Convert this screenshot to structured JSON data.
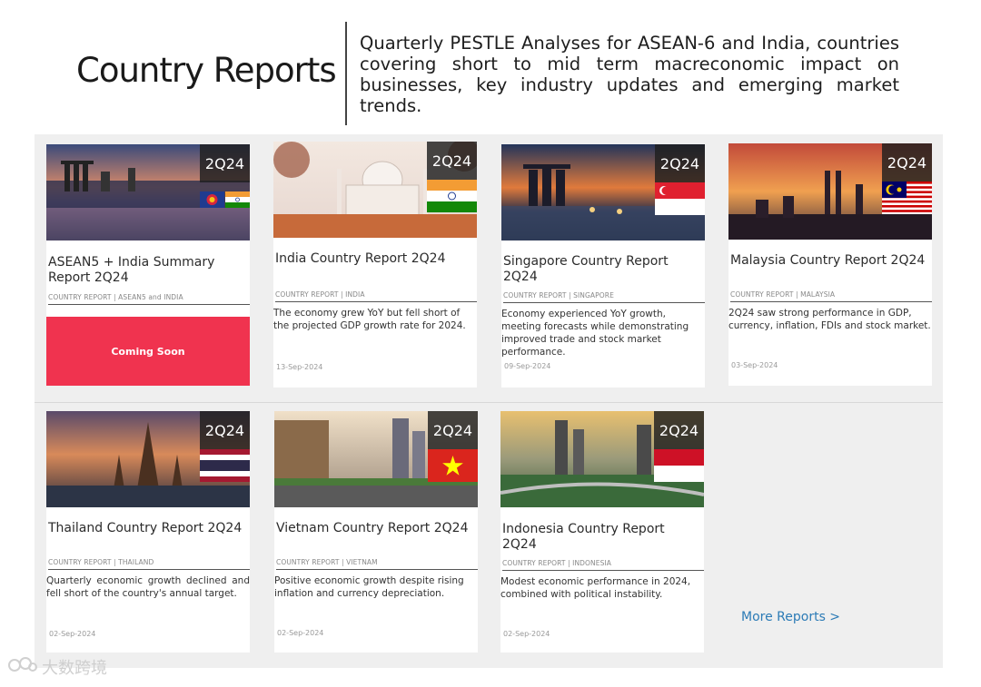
{
  "header": {
    "title": "Country Reports",
    "description": "Quarterly PESTLE Analyses for ASEAN-6 and India, countries covering short to mid term macreconomic impact on businesses, key industry updates and emerging market trends."
  },
  "cards": [
    {
      "quarter": "2Q24",
      "title": "ASEAN5 + India Summary Report 2Q24",
      "category": "COUNTRY REPORT | ASEAN5 and INDIA",
      "summary": "",
      "date": "",
      "cta": "Coming Soon",
      "flags": [
        "asean-flag",
        "india-flag"
      ]
    },
    {
      "quarter": "2Q24",
      "title": "India Country Report 2Q24",
      "category": "COUNTRY REPORT | INDIA",
      "summary": "The economy grew YoY but fell short of the projected GDP growth rate for 2024.",
      "date": "13-Sep-2024",
      "flags": [
        "india-flag"
      ]
    },
    {
      "quarter": "2Q24",
      "title": "Singapore Country Report 2Q24",
      "category": "COUNTRY REPORT | SINGAPORE",
      "summary": "Economy experienced YoY growth, meeting forecasts while demonstrating improved trade and stock market performance.",
      "date": "09-Sep-2024",
      "flags": [
        "singapore-flag"
      ]
    },
    {
      "quarter": "2Q24",
      "title": "Malaysia Country Report 2Q24",
      "category": "COUNTRY REPORT | MALAYSIA",
      "summary": "2Q24 saw strong performance in GDP, currency, inflation, FDIs and stock market.",
      "date": "03-Sep-2024",
      "flags": [
        "malaysia-flag"
      ]
    },
    {
      "quarter": "2Q24",
      "title": "Thailand Country Report 2Q24",
      "category": "COUNTRY REPORT | THAILAND",
      "summary": "Quarterly economic growth declined and fell short of the country's annual target.",
      "date": "02-Sep-2024",
      "flags": [
        "thailand-flag"
      ]
    },
    {
      "quarter": "2Q24",
      "title": "Vietnam Country Report 2Q24",
      "category": "COUNTRY REPORT | VIETNAM",
      "summary": "Positive economic growth despite rising inflation and currency depreciation.",
      "date": "02-Sep-2024",
      "flags": [
        "vietnam-flag"
      ]
    },
    {
      "quarter": "2Q24",
      "title": "Indonesia Country Report 2Q24",
      "category": "COUNTRY REPORT | INDONESIA",
      "summary": "Modest economic performance in 2024, combined with political instability.",
      "date": "02-Sep-2024",
      "flags": [
        "indonesia-flag"
      ]
    }
  ],
  "more_reports": "More Reports >",
  "watermark": "大数跨境",
  "colors": {
    "coming_soon_bg": "#f0334f",
    "link": "#2c7bb6",
    "panel_bg": "#efefef"
  }
}
